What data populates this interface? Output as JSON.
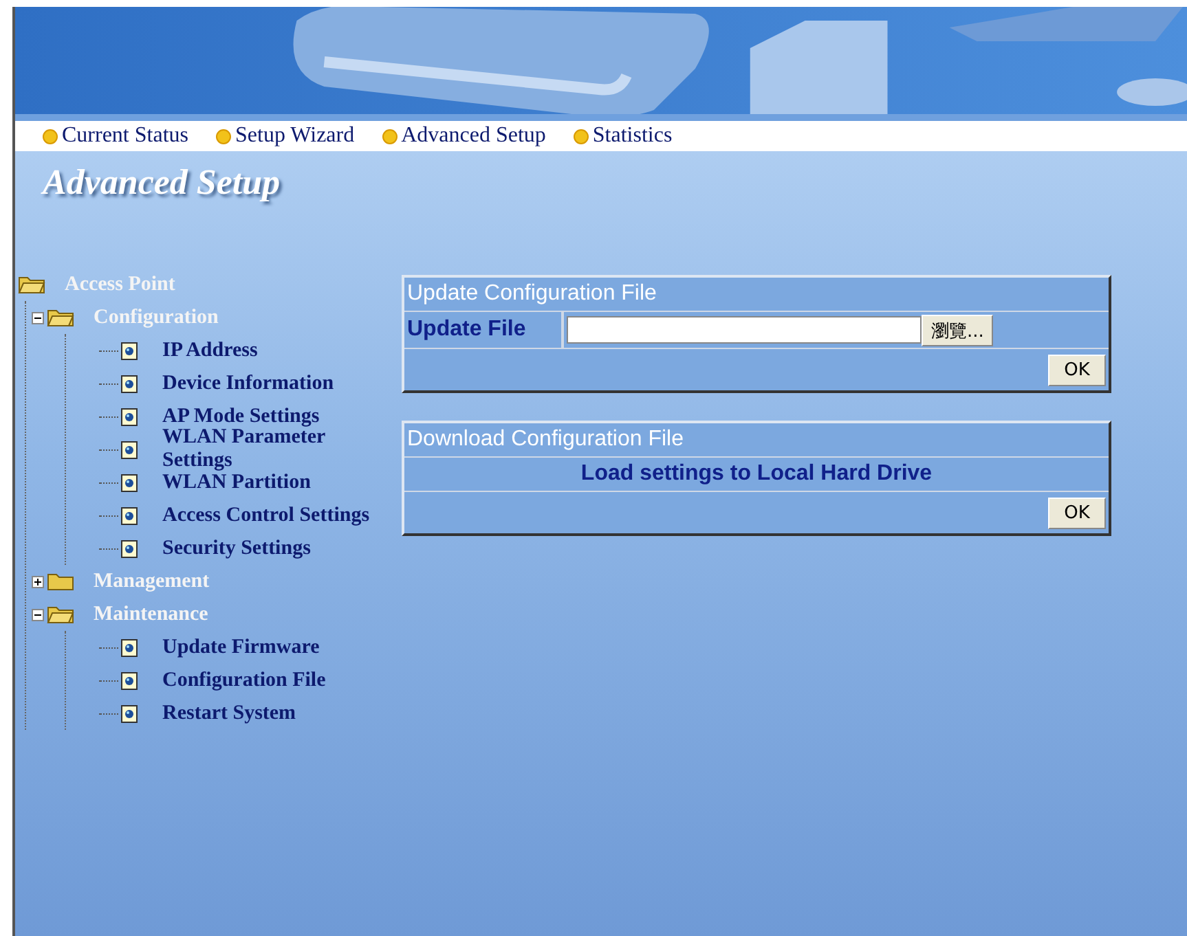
{
  "nav": [
    {
      "label": "Current Status"
    },
    {
      "label": "Setup Wizard"
    },
    {
      "label": "Advanced Setup"
    },
    {
      "label": "Statistics"
    }
  ],
  "page_title": "Advanced Setup",
  "tree": [
    {
      "kind": "folder",
      "label": "Access Point",
      "children": [
        {
          "kind": "folder",
          "label": "Configuration",
          "expanded": true,
          "children": [
            {
              "kind": "page",
              "label": "IP Address"
            },
            {
              "kind": "page",
              "label": "Device Information"
            },
            {
              "kind": "page",
              "label": "AP Mode Settings"
            },
            {
              "kind": "page",
              "label": "WLAN  Parameter Settings"
            },
            {
              "kind": "page",
              "label": "WLAN  Partition"
            },
            {
              "kind": "page",
              "label": "Access Control Settings"
            },
            {
              "kind": "page",
              "label": "Security Settings"
            }
          ]
        },
        {
          "kind": "folder",
          "label": "Management",
          "expanded": false
        },
        {
          "kind": "folder",
          "label": "Maintenance",
          "expanded": true,
          "children": [
            {
              "kind": "page",
              "label": "Update Firmware"
            },
            {
              "kind": "page",
              "label": "Configuration File"
            },
            {
              "kind": "page",
              "label": "Restart System"
            }
          ]
        }
      ]
    }
  ],
  "update_panel": {
    "title": "Update Configuration File",
    "field_label": "Update File",
    "browse_button": "瀏覽...",
    "ok_button": "OK"
  },
  "download_panel": {
    "title": "Download Configuration File",
    "message": "Load settings to Local Hard Drive",
    "ok_button": "OK"
  }
}
